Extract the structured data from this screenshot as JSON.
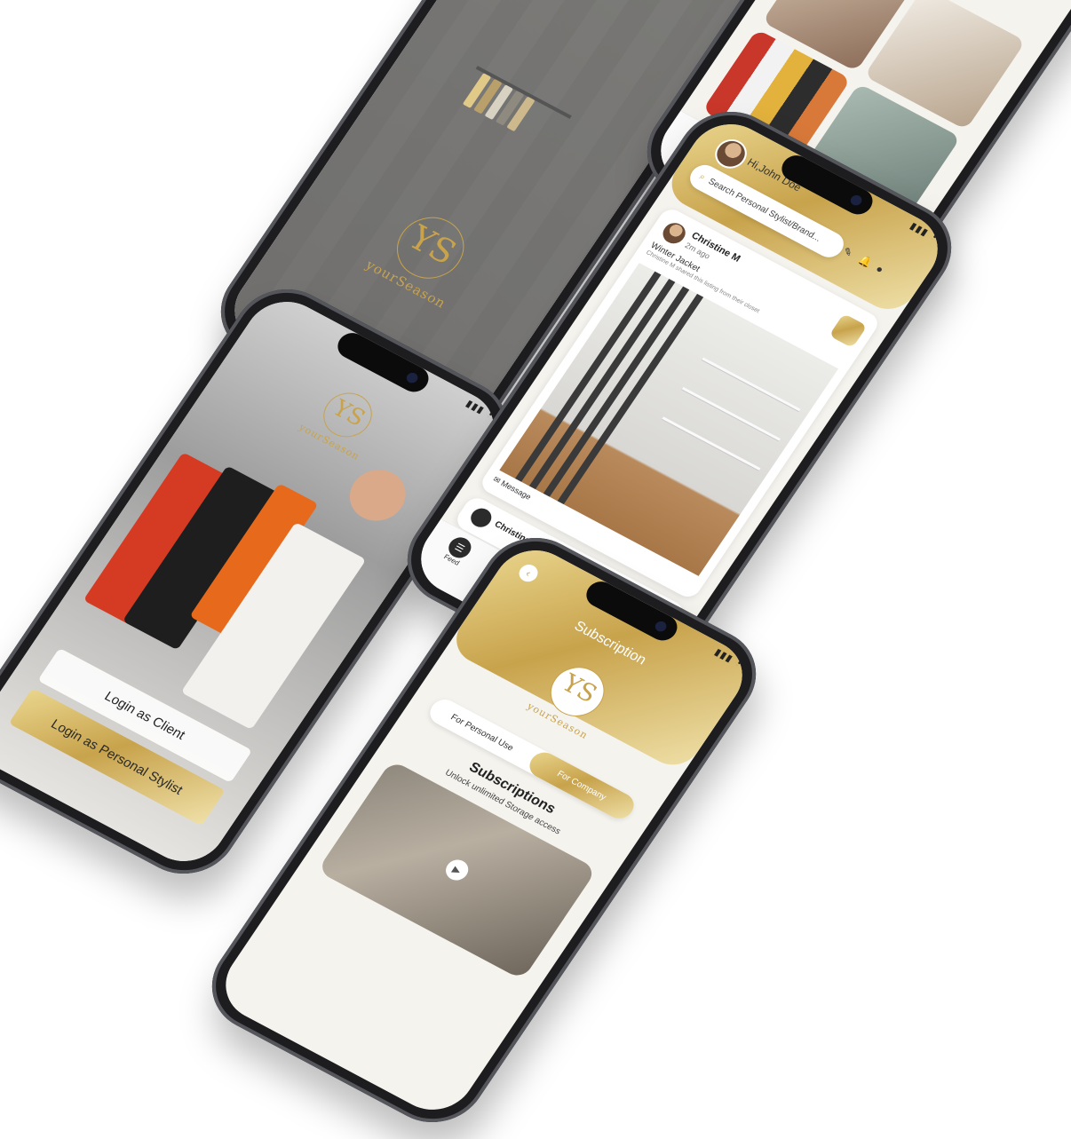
{
  "brand": {
    "mark": "YS",
    "wordmark": "yourSeason",
    "gold": "#c8a34c",
    "gold_light": "#e9d58d"
  },
  "status_bar": {
    "icons": "▮▮▮ ◔"
  },
  "splash": {
    "logo_mark": "YS",
    "wordmark": "yourSeason"
  },
  "login": {
    "logo_mark": "YS",
    "wordmark": "yourSeason",
    "client_button": "Login as Client",
    "stylist_button": "Login as Personal Stylist"
  },
  "feed": {
    "greeting": "Hi,John Doe",
    "search_placeholder": "Search Personal Stylist/Brand...",
    "icons": [
      "edit-icon",
      "bell-icon",
      "notification-icon"
    ],
    "post": {
      "author": "Christine M",
      "time": "2m ago",
      "title": "Winter Jacket",
      "caption": "Christine M shared this listing from their closet"
    },
    "message_label": "Message",
    "second_author": "Christine M",
    "feed_label": "Feed",
    "tabs": [
      "heart-icon",
      "home-logo-icon",
      "chat-icon",
      "settings-icon"
    ]
  },
  "subscription": {
    "title": "Subscription",
    "logo_mark": "YS",
    "wordmark": "yourSeason",
    "segment_personal": "For Personal Use",
    "segment_company": "For Company",
    "heading": "Subscriptions",
    "subheading": "Unlock unlimited Storage access"
  }
}
